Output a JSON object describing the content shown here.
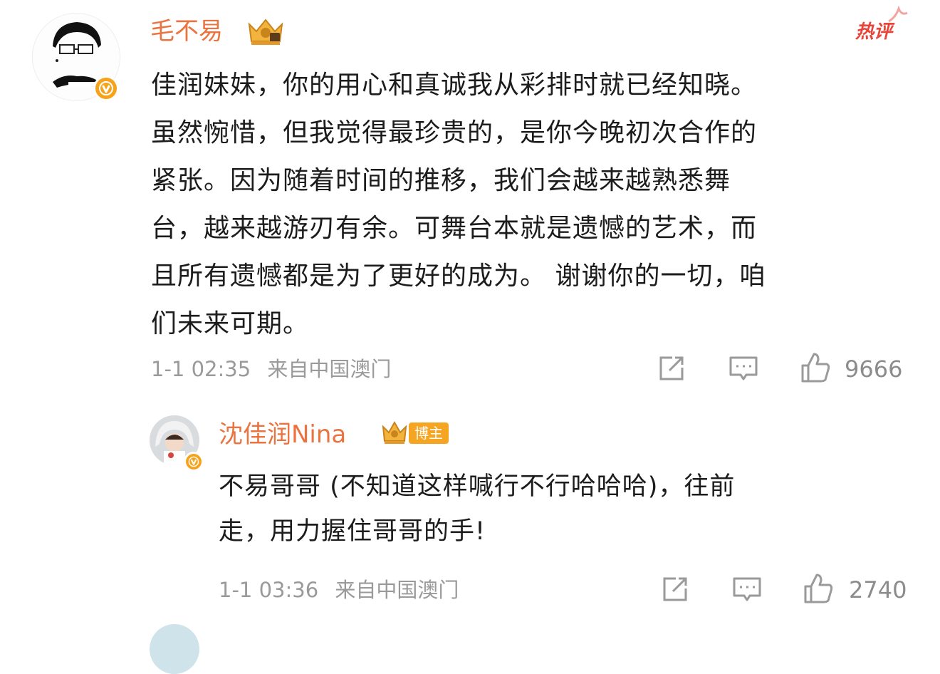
{
  "comment": {
    "username": "毛不易",
    "hot_label": "热评",
    "text_lines": [
      "佳润妹妹，你的用心和真诚我从彩排时就已经知晓。",
      "虽然惋惜，但我觉得最珍贵的，是你今晚初次合作的",
      "紧张。因为随着时间的推移，我们会越来越熟悉舞",
      "台，越来越游刃有余。可舞台本就是遗憾的艺术，而",
      "且所有遗憾都是为了更好的成为。 谢谢你的一切，咱",
      "们未来可期。"
    ],
    "timestamp": "1-1 02:35",
    "location": "来自中国澳门",
    "likes": "9666",
    "icons": {
      "share": "share-icon",
      "comment": "comment-icon",
      "like": "like-icon",
      "verified": "verified-badge-icon",
      "crown": "crown-badge-icon"
    }
  },
  "reply": {
    "username": "沈佳润Nina",
    "tag": "博主",
    "text_lines": [
      "不易哥哥 (不知道这样喊行不行哈哈哈)，往前",
      "走，用力握住哥哥的手!"
    ],
    "timestamp": "1-1 03:36",
    "location": "来自中国澳门",
    "likes": "2740"
  },
  "colors": {
    "username": "#eb7340",
    "hot": "#e8443a",
    "meta": "#9a9a9a",
    "verified": "#f7a21b",
    "tag": "#f6a523"
  }
}
